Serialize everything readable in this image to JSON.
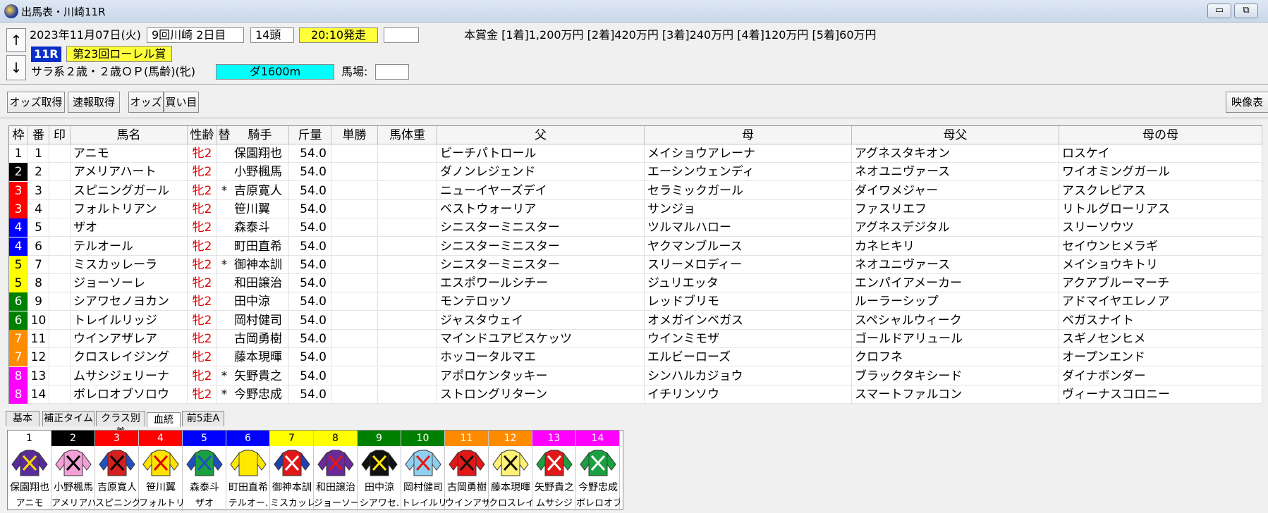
{
  "window": {
    "title": "出馬表・川崎11R",
    "min_label": "▭",
    "restore_label": "⧉"
  },
  "nav": {
    "up": "↑",
    "down": "↓"
  },
  "race": {
    "date": "2023年11月07日(火)",
    "meeting": "9回川崎 2日目",
    "runners": "14頭",
    "post_time": "20:10発走",
    "number": "11R",
    "name": "第23回ローレル賞",
    "conditions": "サラ系２歳・２歳ＯＰ(馬齢)(牝)",
    "distance": "ダ1600m",
    "baba_label": "馬場:",
    "baba_value": "",
    "blank_field": "",
    "prize": "本賞金 [1着]1,200万円 [2着]420万円 [3着]240万円 [4着]120万円 [5着]60万円"
  },
  "toolbar": {
    "odds_fetch": "オッズ取得",
    "sokuhou_fetch": "速報取得",
    "odds": "オッズ",
    "kaime": "買い目",
    "eizou": "映像表"
  },
  "columns": [
    "枠",
    "番",
    "印",
    "馬名",
    "性齢",
    "替",
    "騎手",
    "斤量",
    "単勝",
    "馬体重",
    "父",
    "母",
    "母父",
    "母の母"
  ],
  "waku_colors": {
    "1": "#ffffff",
    "2": "#000000",
    "3": "#ff0000",
    "4": "#0000ff",
    "5": "#ffff00",
    "6": "#008000",
    "7": "#ff8c00",
    "8": "#ff00ff"
  },
  "waku_text_colors": {
    "1": "#000000",
    "2": "#ffffff",
    "3": "#ffffff",
    "4": "#ffffff",
    "5": "#000000",
    "6": "#ffffff",
    "7": "#ffffff",
    "8": "#ffffff"
  },
  "entries": [
    {
      "waku": "1",
      "ban": "1",
      "mark": "",
      "horse": "アニモ",
      "sexage": "牝2",
      "change": "",
      "jockey": "保園翔也",
      "weight": "54.0",
      "odds": "",
      "bodyweight": "",
      "sire": "ビーチパトロール",
      "dam": "メイショウアレーナ",
      "damsire": "アグネスタキオン",
      "damdam": "ロスケイ"
    },
    {
      "waku": "2",
      "ban": "2",
      "mark": "",
      "horse": "アメリアハート",
      "sexage": "牝2",
      "change": "",
      "jockey": "小野楓馬",
      "weight": "54.0",
      "odds": "",
      "bodyweight": "",
      "sire": "ダノンレジェンド",
      "dam": "エーシンウェンディ",
      "damsire": "ネオユニヴァース",
      "damdam": "ワイオミングガール"
    },
    {
      "waku": "3",
      "ban": "3",
      "mark": "",
      "horse": "スピニングガール",
      "sexage": "牝2",
      "change": "*",
      "jockey": "吉原寛人",
      "weight": "54.0",
      "odds": "",
      "bodyweight": "",
      "sire": "ニューイヤーズデイ",
      "dam": "セラミックガール",
      "damsire": "ダイワメジャー",
      "damdam": "アスクレピアス"
    },
    {
      "waku": "3",
      "ban": "4",
      "mark": "",
      "horse": "フォルトリアン",
      "sexage": "牝2",
      "change": "",
      "jockey": "笹川翼",
      "weight": "54.0",
      "odds": "",
      "bodyweight": "",
      "sire": "ベストウォーリア",
      "dam": "サンジョ",
      "damsire": "ファスリエフ",
      "damdam": "リトルグローリアス"
    },
    {
      "waku": "4",
      "ban": "5",
      "mark": "",
      "horse": "ザオ",
      "sexage": "牝2",
      "change": "",
      "jockey": "森泰斗",
      "weight": "54.0",
      "odds": "",
      "bodyweight": "",
      "sire": "シニスターミニスター",
      "dam": "ツルマルハロー",
      "damsire": "アグネスデジタル",
      "damdam": "スリーソウツ"
    },
    {
      "waku": "4",
      "ban": "6",
      "mark": "",
      "horse": "テルオール",
      "sexage": "牝2",
      "change": "",
      "jockey": "町田直希",
      "weight": "54.0",
      "odds": "",
      "bodyweight": "",
      "sire": "シニスターミニスター",
      "dam": "ヤクマンブルース",
      "damsire": "カネヒキリ",
      "damdam": "セイウンヒメラギ"
    },
    {
      "waku": "5",
      "ban": "7",
      "mark": "",
      "horse": "ミスカッレーラ",
      "sexage": "牝2",
      "change": "*",
      "jockey": "御神本訓",
      "weight": "54.0",
      "odds": "",
      "bodyweight": "",
      "sire": "シニスターミニスター",
      "dam": "スリーメロディー",
      "damsire": "ネオユニヴァース",
      "damdam": "メイショウキトリ"
    },
    {
      "waku": "5",
      "ban": "8",
      "mark": "",
      "horse": "ジョーソーレ",
      "sexage": "牝2",
      "change": "",
      "jockey": "和田譲治",
      "weight": "54.0",
      "odds": "",
      "bodyweight": "",
      "sire": "エスポワールシチー",
      "dam": "ジュリエッタ",
      "damsire": "エンパイアメーカー",
      "damdam": "アクアブルーマーチ"
    },
    {
      "waku": "6",
      "ban": "9",
      "mark": "",
      "horse": "シアワセノヨカン",
      "sexage": "牝2",
      "change": "",
      "jockey": "田中涼",
      "weight": "54.0",
      "odds": "",
      "bodyweight": "",
      "sire": "モンテロッソ",
      "dam": "レッドブリモ",
      "damsire": "ルーラーシップ",
      "damdam": "アドマイヤエレノア"
    },
    {
      "waku": "6",
      "ban": "10",
      "mark": "",
      "horse": "トレイルリッジ",
      "sexage": "牝2",
      "change": "",
      "jockey": "岡村健司",
      "weight": "54.0",
      "odds": "",
      "bodyweight": "",
      "sire": "ジャスタウェイ",
      "dam": "オメガインベガス",
      "damsire": "スペシャルウィーク",
      "damdam": "ベガスナイト"
    },
    {
      "waku": "7",
      "ban": "11",
      "mark": "",
      "horse": "ウインアザレア",
      "sexage": "牝2",
      "change": "",
      "jockey": "古岡勇樹",
      "weight": "54.0",
      "odds": "",
      "bodyweight": "",
      "sire": "マインドユアビスケッツ",
      "dam": "ウインミモザ",
      "damsire": "ゴールドアリュール",
      "damdam": "スギノセンヒメ"
    },
    {
      "waku": "7",
      "ban": "12",
      "mark": "",
      "horse": "クロスレイジング",
      "sexage": "牝2",
      "change": "",
      "jockey": "藤本現暉",
      "weight": "54.0",
      "odds": "",
      "bodyweight": "",
      "sire": "ホッコータルマエ",
      "dam": "エルビーローズ",
      "damsire": "クロフネ",
      "damdam": "オープンエンド"
    },
    {
      "waku": "8",
      "ban": "13",
      "mark": "",
      "horse": "ムサシジェリーナ",
      "sexage": "牝2",
      "change": "*",
      "jockey": "矢野貴之",
      "weight": "54.0",
      "odds": "",
      "bodyweight": "",
      "sire": "アポロケンタッキー",
      "dam": "シンハルカジョウ",
      "damsire": "ブラックタキシード",
      "damdam": "ダイナボンダー"
    },
    {
      "waku": "8",
      "ban": "14",
      "mark": "",
      "horse": "ボレロオブソロウ",
      "sexage": "牝2",
      "change": "*",
      "jockey": "今野忠成",
      "weight": "54.0",
      "odds": "",
      "bodyweight": "",
      "sire": "ストロングリターン",
      "dam": "イチリンソウ",
      "damsire": "スマートファルコン",
      "damdam": "ヴィーナスコロニー"
    }
  ],
  "tabs": [
    "基本",
    "補正タイム",
    "クラス別着",
    "血統",
    "前5走A"
  ],
  "active_tab": "血統",
  "silks": [
    {
      "num": "1",
      "jockey": "保園翔也",
      "horse": "アニモ",
      "body": "#5a2b9a",
      "trim": "#ffd800",
      "sleeve": "#5a2b9a"
    },
    {
      "num": "2",
      "jockey": "小野楓馬",
      "horse": "アメリアハ",
      "body": "#f3a0d8",
      "trim": "#000000",
      "sleeve": "#f3a0d8"
    },
    {
      "num": "3",
      "jockey": "吉原寛人",
      "horse": "スピニング",
      "body": "#d42020",
      "trim": "#000000",
      "sleeve": "#2050c0"
    },
    {
      "num": "4",
      "jockey": "笹川翼",
      "horse": "フォルトリ",
      "body": "#ffe200",
      "trim": "#e00000",
      "sleeve": "#ffe200"
    },
    {
      "num": "5",
      "jockey": "森泰斗",
      "horse": "ザオ",
      "body": "#1aa040",
      "trim": "#2050c0",
      "sleeve": "#2050c0"
    },
    {
      "num": "6",
      "jockey": "町田直希",
      "horse": "テルオー.",
      "body": "#ffe800",
      "trim": "#ffe800",
      "sleeve": "#ffe800"
    },
    {
      "num": "7",
      "jockey": "御神本訓",
      "horse": "ミスカッレ",
      "body": "#e01818",
      "trim": "#ffffff",
      "sleeve": "#2040b0"
    },
    {
      "num": "8",
      "jockey": "和田譲治",
      "horse": "ジョーソー",
      "body": "#6a2a9a",
      "trim": "#e01818",
      "sleeve": "#6a2a9a"
    },
    {
      "num": "9",
      "jockey": "田中涼",
      "horse": "シアワセ.",
      "body": "#111111",
      "trim": "#ffe800",
      "sleeve": "#111111"
    },
    {
      "num": "10",
      "jockey": "岡村健司",
      "horse": "トレイルリ",
      "body": "#8fd0f0",
      "trim": "#e01818",
      "sleeve": "#8fd0f0"
    },
    {
      "num": "11",
      "jockey": "古岡勇樹",
      "horse": "ウインアザ",
      "body": "#e01818",
      "trim": "#111111",
      "sleeve": "#e01818"
    },
    {
      "num": "12",
      "jockey": "藤本現暉",
      "horse": "クロスレイ",
      "body": "#fff176",
      "trim": "#111111",
      "sleeve": "#fff176"
    },
    {
      "num": "13",
      "jockey": "矢野貴之",
      "horse": "ムサシジ",
      "body": "#e01818",
      "trim": "#ffffff",
      "sleeve": "#1aa040"
    },
    {
      "num": "14",
      "jockey": "今野忠成",
      "horse": "ボレロオブ",
      "body": "#1aa040",
      "trim": "#ffffff",
      "sleeve": "#1aa040"
    }
  ]
}
